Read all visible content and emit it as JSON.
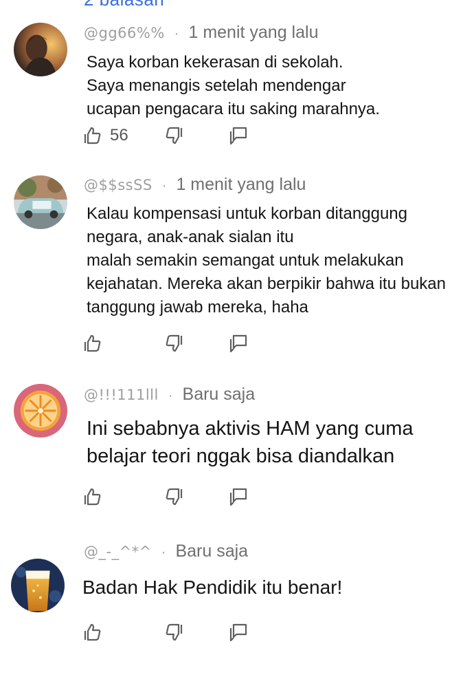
{
  "top_partial_text": "2 balasan",
  "comments": [
    {
      "username": "@gg66%%",
      "time": "1 menit yang lalu",
      "lines": [
        "Saya korban kekerasan di sekolah.",
        "Saya menangis setelah mendengar",
        "ucapan pengacara itu saking marahnya."
      ],
      "likes": "56"
    },
    {
      "username": "@$$ssSS",
      "time": "1 menit yang lalu",
      "lines": [
        "Kalau kompensasi untuk korban ditanggung",
        "negara, anak-anak sialan itu",
        "malah semakin semangat untuk melakukan",
        "kejahatan. Mereka akan berpikir bahwa itu bukan",
        "tanggung jawab mereka, haha"
      ],
      "likes": ""
    },
    {
      "username": "@!!!111lll",
      "time": "Baru saja",
      "lines": [
        "Ini sebabnya aktivis HAM yang cuma",
        "belajar teori nggak bisa diandalkan"
      ],
      "likes": ""
    },
    {
      "username": "@_-_^*^",
      "time": "Baru saja",
      "lines": [
        "Badan Hak Pendidik itu benar!"
      ],
      "likes": ""
    }
  ],
  "separator": "·",
  "icons": {
    "like": "thumbs-up-icon",
    "dislike": "thumbs-down-icon",
    "reply": "reply-icon"
  },
  "colors": {
    "username": "#9e9e9e",
    "time": "#6f6f6f",
    "text": "#151515",
    "icon": "#5f5f5f",
    "link": "#3a6fd8"
  }
}
